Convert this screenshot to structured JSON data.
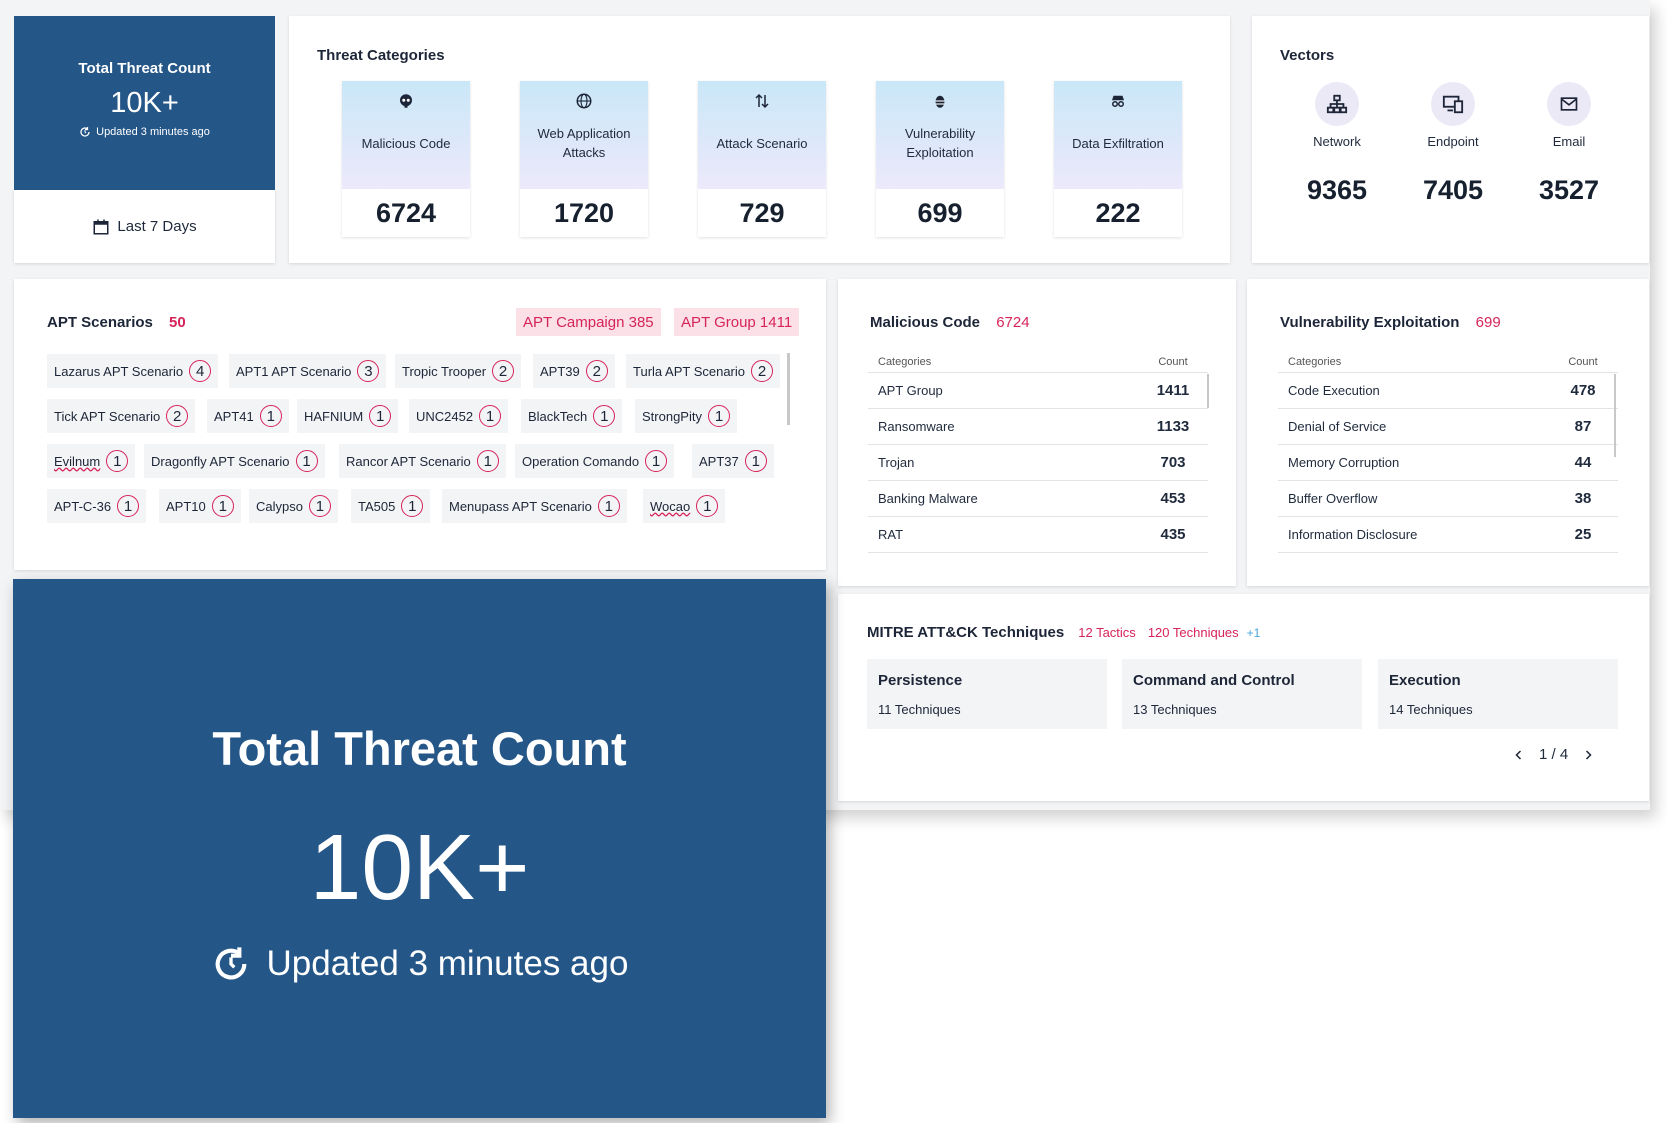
{
  "total_threat_card": {
    "title": "Total Threat Count",
    "value": "10K+",
    "updated": "Updated 3 minutes ago",
    "date_filter": "Last 7 Days"
  },
  "threat_categories": {
    "title": "Threat Categories",
    "items": [
      {
        "label": "Malicious Code",
        "value": "6724",
        "icon": "skull-icon"
      },
      {
        "label": "Web Application Attacks",
        "value": "1720",
        "icon": "globe-icon"
      },
      {
        "label": "Attack Scenario",
        "value": "729",
        "icon": "arrows-up-down-icon"
      },
      {
        "label": "Vulnerability Exploitation",
        "value": "699",
        "icon": "bug-icon"
      },
      {
        "label": "Data Exfiltration",
        "value": "222",
        "icon": "spy-icon"
      }
    ]
  },
  "vectors": {
    "title": "Vectors",
    "items": [
      {
        "label": "Network",
        "value": "9365",
        "icon": "network-icon"
      },
      {
        "label": "Endpoint",
        "value": "7405",
        "icon": "devices-icon"
      },
      {
        "label": "Email",
        "value": "3527",
        "icon": "email-icon"
      }
    ]
  },
  "apt_scenarios": {
    "title": "APT Scenarios",
    "count": "50",
    "campaign_tag": "APT Campaign 385",
    "group_tag": "APT Group 1411",
    "chips": [
      {
        "label": "Lazarus APT Scenario",
        "count": "4"
      },
      {
        "label": "APT1 APT Scenario",
        "count": "3"
      },
      {
        "label": "Tropic Trooper",
        "count": "2"
      },
      {
        "label": "APT39",
        "count": "2"
      },
      {
        "label": "Turla APT Scenario",
        "count": "2"
      },
      {
        "label": "Tick APT Scenario",
        "count": "2"
      },
      {
        "label": "APT41",
        "count": "1"
      },
      {
        "label": "HAFNIUM",
        "count": "1"
      },
      {
        "label": "UNC2452",
        "count": "1"
      },
      {
        "label": "BlackTech",
        "count": "1"
      },
      {
        "label": "StrongPity",
        "count": "1"
      },
      {
        "label": "Evilnum",
        "count": "1"
      },
      {
        "label": "Dragonfly APT Scenario",
        "count": "1"
      },
      {
        "label": "Rancor APT Scenario",
        "count": "1"
      },
      {
        "label": "Operation Comando",
        "count": "1"
      },
      {
        "label": "APT37",
        "count": "1"
      },
      {
        "label": "APT-C-36",
        "count": "1"
      },
      {
        "label": "APT10",
        "count": "1"
      },
      {
        "label": "Calypso",
        "count": "1"
      },
      {
        "label": "TA505",
        "count": "1"
      },
      {
        "label": "Menupass APT Scenario",
        "count": "1"
      },
      {
        "label": "Wocao",
        "count": "1"
      }
    ]
  },
  "malicious_code": {
    "title": "Malicious Code",
    "count": "6724",
    "col_categories": "Categories",
    "col_count": "Count",
    "rows": [
      {
        "name": "APT Group",
        "value": "1411"
      },
      {
        "name": "Ransomware",
        "value": "1133"
      },
      {
        "name": "Trojan",
        "value": "703"
      },
      {
        "name": "Banking Malware",
        "value": "453"
      },
      {
        "name": "RAT",
        "value": "435"
      }
    ]
  },
  "vuln_exploitation": {
    "title": "Vulnerability Exploitation",
    "count": "699",
    "col_categories": "Categories",
    "col_count": "Count",
    "rows": [
      {
        "name": "Code Execution",
        "value": "478"
      },
      {
        "name": "Denial of Service",
        "value": "87"
      },
      {
        "name": "Memory Corruption",
        "value": "44"
      },
      {
        "name": "Buffer Overflow",
        "value": "38"
      },
      {
        "name": "Information Disclosure",
        "value": "25"
      }
    ]
  },
  "mitre": {
    "title": "MITRE ATT&CK Techniques",
    "tactics": "12 Tactics",
    "techniques": "120 Techniques",
    "extra": "+1",
    "cards": [
      {
        "title": "Persistence",
        "sub": "11 Techniques"
      },
      {
        "title": "Command and Control",
        "sub": "13 Techniques"
      },
      {
        "title": "Execution",
        "sub": "14 Techniques"
      }
    ],
    "pager": "1 / 4"
  },
  "big_overlay": {
    "title": "Total Threat Count",
    "value": "10K+",
    "updated": "Updated 3 minutes ago"
  },
  "colors": {
    "primary_blue": "#245688",
    "accent_red": "#d6245a",
    "chip_bg": "#f3f4f6"
  }
}
